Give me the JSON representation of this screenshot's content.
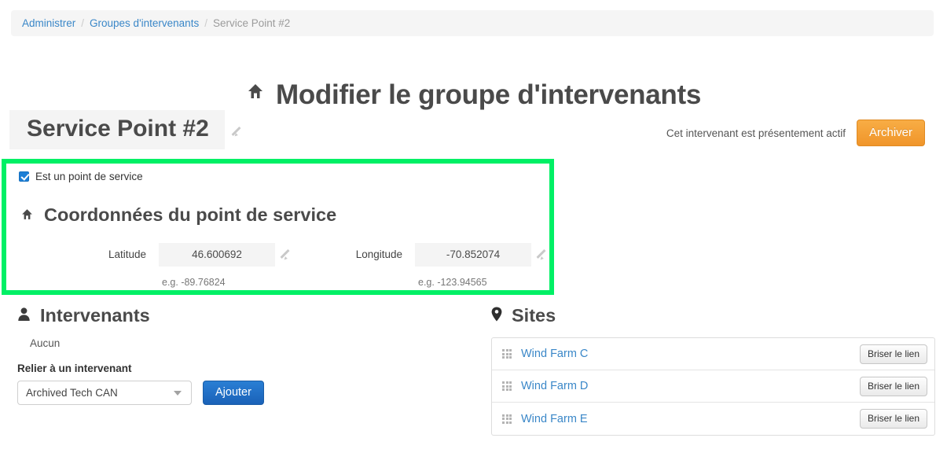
{
  "breadcrumb": {
    "items": [
      {
        "label": "Administrer",
        "link": true
      },
      {
        "label": "Groupes d'intervenants",
        "link": true
      },
      {
        "label": "Service Point #2",
        "link": false
      }
    ],
    "separator": "/"
  },
  "header": {
    "title": "Modifier le groupe d'intervenants",
    "title_icon": "home-icon"
  },
  "entity": {
    "name": "Service Point #2",
    "edit_icon": "pencil-icon"
  },
  "archive": {
    "status_text": "Cet intervenant est présentement actif",
    "button_label": "Archiver",
    "button_color": "#f0952a"
  },
  "service_point": {
    "highlight_color": "#00f065",
    "checkbox": {
      "label": "Est un point de service",
      "checked": true,
      "color": "#1d7fd6"
    },
    "heading": "Coordonnées du point de service",
    "heading_icon": "home-icon",
    "latitude": {
      "label": "Latitude",
      "value": "46.600692",
      "hint": "e.g. -89.76824",
      "edit_icon": "pencil-icon"
    },
    "longitude": {
      "label": "Longitude",
      "value": "-70.852074",
      "hint": "e.g. -123.94565",
      "edit_icon": "pencil-icon"
    }
  },
  "intervenants": {
    "heading": "Intervenants",
    "heading_icon": "user-icon",
    "empty_text": "Aucun",
    "link_label": "Relier à un intervenant",
    "select_value": "Archived Tech CAN",
    "select_icon": "chevron-down-icon",
    "add_button_label": "Ajouter"
  },
  "sites": {
    "heading": "Sites",
    "heading_icon": "map-pin-icon",
    "unlink_label": "Briser le lien",
    "drag_icon": "drag-handle-icon",
    "rows": [
      {
        "name": "Wind Farm C"
      },
      {
        "name": "Wind Farm D"
      },
      {
        "name": "Wind Farm E"
      }
    ]
  }
}
